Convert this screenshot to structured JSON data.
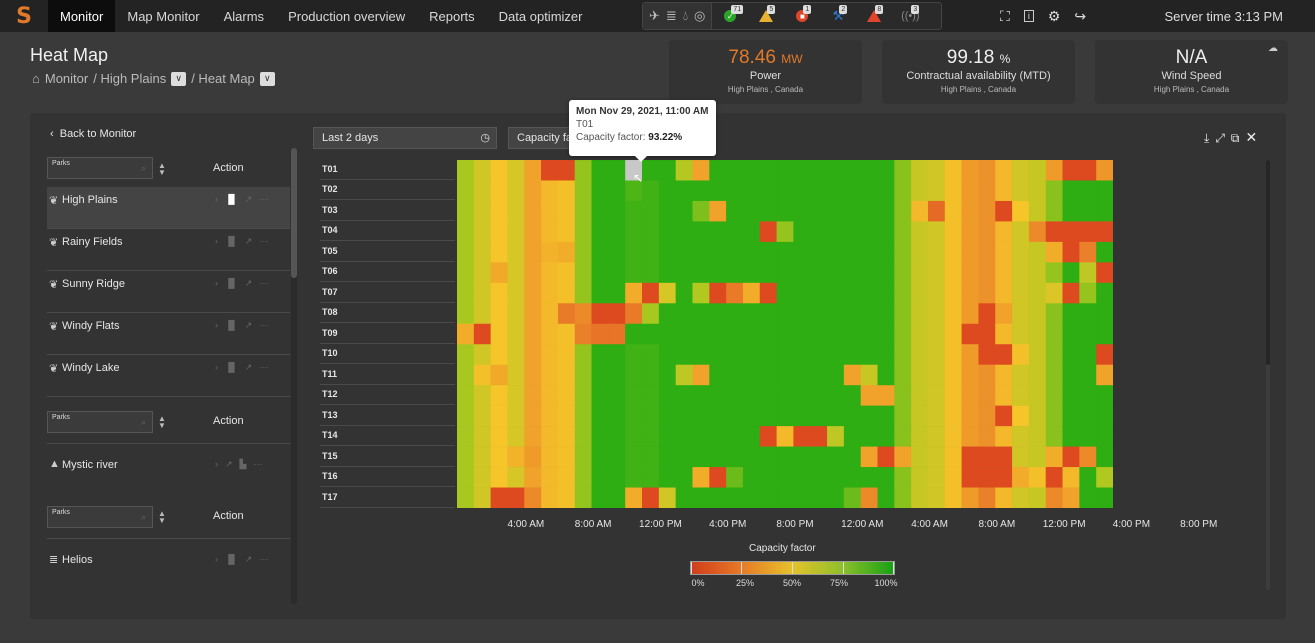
{
  "app": {
    "logo": "S"
  },
  "nav": [
    {
      "label": "Monitor",
      "active": true
    },
    {
      "label": "Map Monitor"
    },
    {
      "label": "Alarms"
    },
    {
      "label": "Production overview"
    },
    {
      "label": "Reports"
    },
    {
      "label": "Data optimizer"
    }
  ],
  "asset_types": [
    "wind-turbine-icon",
    "solar-panel-icon",
    "hydro-drop-icon",
    "storage-icon"
  ],
  "alarms": [
    {
      "name": "ok",
      "count": "71",
      "color": "#2aa52a"
    },
    {
      "name": "warning",
      "count": "5",
      "color": "#e8b030"
    },
    {
      "name": "stop",
      "count": "1",
      "color": "#e0442a"
    },
    {
      "name": "maintenance",
      "count": "2",
      "color": "#2a7ad0"
    },
    {
      "name": "critical",
      "count": "8",
      "color": "#e0442a"
    },
    {
      "name": "communication",
      "count": "3",
      "color": "#888888"
    }
  ],
  "server_time": "Server time 3:13 PM",
  "page": {
    "title": "Heat Map",
    "breadcrumb": [
      "Monitor",
      "/ High Plains",
      "/ Heat Map"
    ]
  },
  "kpis": [
    {
      "value": "78.46",
      "unit": "MW",
      "label": "Power",
      "sub": "High Plains , Canada",
      "color": "#e07a2a"
    },
    {
      "value": "99.18",
      "unit": "%",
      "label": "Contractual availability (MTD)",
      "sub": "High Plains , Canada",
      "color": "#eeeeee"
    },
    {
      "value": "N/A",
      "unit": "",
      "label": "Wind Speed",
      "sub": "High Plains , Canada",
      "color": "#eeeeee"
    }
  ],
  "sidebar": {
    "back_label": "Back to Monitor",
    "search_placeholder": "Parks",
    "action_label": "Action",
    "groups": [
      {
        "parks": [
          {
            "name": "High Plains",
            "icon": "wind-turbine-icon",
            "selected": true
          },
          {
            "name": "Rainy Fields",
            "icon": "wind-turbine-icon"
          },
          {
            "name": "Sunny Ridge",
            "icon": "wind-turbine-icon"
          },
          {
            "name": "Windy Flats",
            "icon": "wind-turbine-icon"
          },
          {
            "name": "Windy Lake",
            "icon": "wind-turbine-icon"
          }
        ]
      },
      {
        "parks": [
          {
            "name": "Mystic river",
            "icon": "hydro-icon"
          }
        ]
      },
      {
        "parks": [
          {
            "name": "Helios",
            "icon": "solar-panel-icon"
          }
        ]
      }
    ]
  },
  "controls": {
    "time_range": "Last 2 days",
    "metric": "Capacity factor"
  },
  "tooltip": {
    "date": "Mon Nov 29, 2021, 11:00 AM",
    "turbine": "T01",
    "label": "Capacity factor: ",
    "value": "93.22%"
  },
  "chart_data": {
    "type": "heatmap",
    "title": "",
    "legend_title": "Capacity factor",
    "legend_ticks": [
      "0%",
      "25%",
      "50%",
      "75%",
      "100%"
    ],
    "color_scale": [
      "#d93a1e",
      "#ec8a2a",
      "#f5c52a",
      "#a8c820",
      "#10a810"
    ],
    "value_range": [
      0,
      100
    ],
    "rows": [
      "T01",
      "T02",
      "T03",
      "T04",
      "T05",
      "T06",
      "T07",
      "T08",
      "T09",
      "T10",
      "T11",
      "T12",
      "T13",
      "T14",
      "T15",
      "T16",
      "T17"
    ],
    "x_ticks": [
      "4:00 AM",
      "8:00 AM",
      "12:00 PM",
      "4:00 PM",
      "8:00 PM",
      "12:00 AM",
      "4:00 AM",
      "8:00 AM",
      "12:00 PM",
      "4:00 PM",
      "8:00 PM"
    ],
    "x_tick_positions_hours": [
      4,
      8,
      12,
      16,
      20,
      24,
      28,
      32,
      36,
      40,
      44
    ],
    "hours_start": 1,
    "columns": 39,
    "highlighted_cell": {
      "row": "T01",
      "col": 10,
      "value": 93.22
    },
    "values": [
      [
        75,
        62,
        50,
        60,
        35,
        5,
        5,
        78,
        95,
        95,
        93,
        95,
        95,
        70,
        35,
        95,
        95,
        95,
        95,
        95,
        95,
        95,
        95,
        95,
        95,
        95,
        80,
        65,
        62,
        48,
        32,
        28,
        45,
        62,
        65,
        32,
        5,
        5,
        30
      ],
      [
        75,
        62,
        50,
        60,
        35,
        45,
        48,
        78,
        95,
        95,
        90,
        92,
        95,
        95,
        95,
        95,
        95,
        95,
        95,
        95,
        95,
        95,
        95,
        95,
        95,
        95,
        80,
        65,
        62,
        48,
        32,
        28,
        45,
        62,
        65,
        80,
        95,
        95,
        95
      ],
      [
        75,
        62,
        50,
        60,
        35,
        45,
        48,
        78,
        95,
        95,
        92,
        92,
        95,
        95,
        82,
        35,
        95,
        95,
        95,
        95,
        95,
        95,
        95,
        95,
        95,
        95,
        80,
        45,
        15,
        48,
        32,
        28,
        5,
        50,
        65,
        80,
        95,
        95,
        95
      ],
      [
        75,
        62,
        50,
        60,
        35,
        45,
        48,
        78,
        95,
        95,
        92,
        92,
        95,
        95,
        95,
        95,
        95,
        95,
        5,
        78,
        95,
        95,
        95,
        95,
        95,
        95,
        80,
        65,
        62,
        48,
        32,
        28,
        45,
        62,
        25,
        5,
        5,
        5,
        5
      ],
      [
        75,
        62,
        50,
        60,
        35,
        42,
        40,
        78,
        95,
        95,
        92,
        92,
        95,
        95,
        95,
        95,
        95,
        95,
        95,
        95,
        95,
        95,
        95,
        95,
        95,
        95,
        80,
        65,
        62,
        48,
        32,
        28,
        45,
        62,
        65,
        40,
        5,
        22,
        95
      ],
      [
        75,
        62,
        38,
        60,
        35,
        45,
        48,
        78,
        95,
        95,
        92,
        92,
        95,
        95,
        95,
        95,
        95,
        95,
        95,
        95,
        95,
        95,
        95,
        95,
        95,
        95,
        80,
        65,
        62,
        48,
        32,
        28,
        45,
        62,
        65,
        78,
        95,
        68,
        5
      ],
      [
        75,
        62,
        50,
        60,
        35,
        45,
        48,
        78,
        95,
        95,
        40,
        5,
        60,
        95,
        72,
        5,
        20,
        40,
        5,
        95,
        95,
        95,
        95,
        95,
        95,
        95,
        80,
        65,
        62,
        48,
        32,
        28,
        45,
        62,
        65,
        58,
        5,
        78,
        95
      ],
      [
        75,
        62,
        50,
        60,
        35,
        45,
        20,
        25,
        5,
        5,
        20,
        75,
        95,
        95,
        95,
        95,
        95,
        95,
        95,
        95,
        95,
        95,
        95,
        95,
        95,
        95,
        80,
        65,
        62,
        48,
        32,
        5,
        35,
        62,
        65,
        80,
        95,
        95,
        95
      ],
      [
        40,
        5,
        50,
        60,
        35,
        45,
        48,
        22,
        18,
        18,
        95,
        95,
        95,
        95,
        95,
        95,
        95,
        95,
        95,
        95,
        95,
        95,
        95,
        95,
        95,
        95,
        80,
        65,
        62,
        48,
        5,
        5,
        45,
        62,
        65,
        80,
        95,
        95,
        95
      ],
      [
        75,
        62,
        50,
        60,
        35,
        45,
        48,
        78,
        95,
        95,
        92,
        92,
        95,
        95,
        95,
        95,
        95,
        95,
        95,
        95,
        95,
        95,
        95,
        95,
        95,
        95,
        80,
        65,
        62,
        48,
        32,
        5,
        5,
        48,
        65,
        80,
        95,
        95,
        5
      ],
      [
        75,
        48,
        38,
        60,
        35,
        45,
        48,
        78,
        95,
        95,
        92,
        92,
        95,
        68,
        35,
        95,
        95,
        95,
        95,
        95,
        95,
        95,
        95,
        35,
        65,
        95,
        80,
        65,
        62,
        48,
        32,
        28,
        45,
        62,
        65,
        80,
        95,
        95,
        35
      ],
      [
        75,
        62,
        50,
        60,
        35,
        45,
        48,
        78,
        95,
        95,
        92,
        92,
        95,
        95,
        95,
        95,
        95,
        95,
        95,
        95,
        95,
        95,
        95,
        95,
        35,
        35,
        80,
        65,
        62,
        48,
        32,
        28,
        45,
        62,
        65,
        80,
        95,
        95,
        95
      ],
      [
        75,
        62,
        50,
        60,
        35,
        45,
        48,
        78,
        95,
        95,
        92,
        92,
        95,
        95,
        95,
        95,
        95,
        95,
        95,
        95,
        95,
        95,
        95,
        95,
        95,
        95,
        80,
        65,
        62,
        48,
        32,
        28,
        5,
        50,
        65,
        80,
        95,
        95,
        95
      ],
      [
        75,
        62,
        50,
        60,
        35,
        45,
        48,
        78,
        95,
        95,
        92,
        92,
        95,
        95,
        95,
        95,
        95,
        95,
        5,
        45,
        5,
        5,
        68,
        95,
        95,
        95,
        80,
        65,
        62,
        48,
        32,
        28,
        45,
        62,
        65,
        80,
        95,
        95,
        95
      ],
      [
        75,
        62,
        50,
        42,
        32,
        45,
        48,
        78,
        95,
        95,
        92,
        92,
        95,
        95,
        95,
        95,
        95,
        95,
        95,
        95,
        95,
        95,
        95,
        95,
        35,
        5,
        35,
        65,
        62,
        48,
        5,
        5,
        5,
        62,
        65,
        40,
        5,
        25,
        95
      ],
      [
        75,
        62,
        50,
        60,
        35,
        45,
        48,
        78,
        95,
        95,
        92,
        92,
        95,
        95,
        40,
        5,
        85,
        95,
        95,
        95,
        95,
        95,
        95,
        95,
        95,
        95,
        80,
        65,
        62,
        48,
        5,
        5,
        5,
        40,
        48,
        5,
        45,
        95,
        72
      ],
      [
        75,
        62,
        5,
        5,
        25,
        45,
        48,
        78,
        95,
        95,
        40,
        5,
        62,
        95,
        95,
        95,
        95,
        95,
        95,
        95,
        95,
        95,
        95,
        85,
        25,
        95,
        80,
        65,
        62,
        48,
        32,
        22,
        45,
        62,
        65,
        25,
        35,
        95,
        95
      ]
    ]
  },
  "chart_tools": [
    "download-icon",
    "fit-icon",
    "popout-icon",
    "close-icon"
  ]
}
